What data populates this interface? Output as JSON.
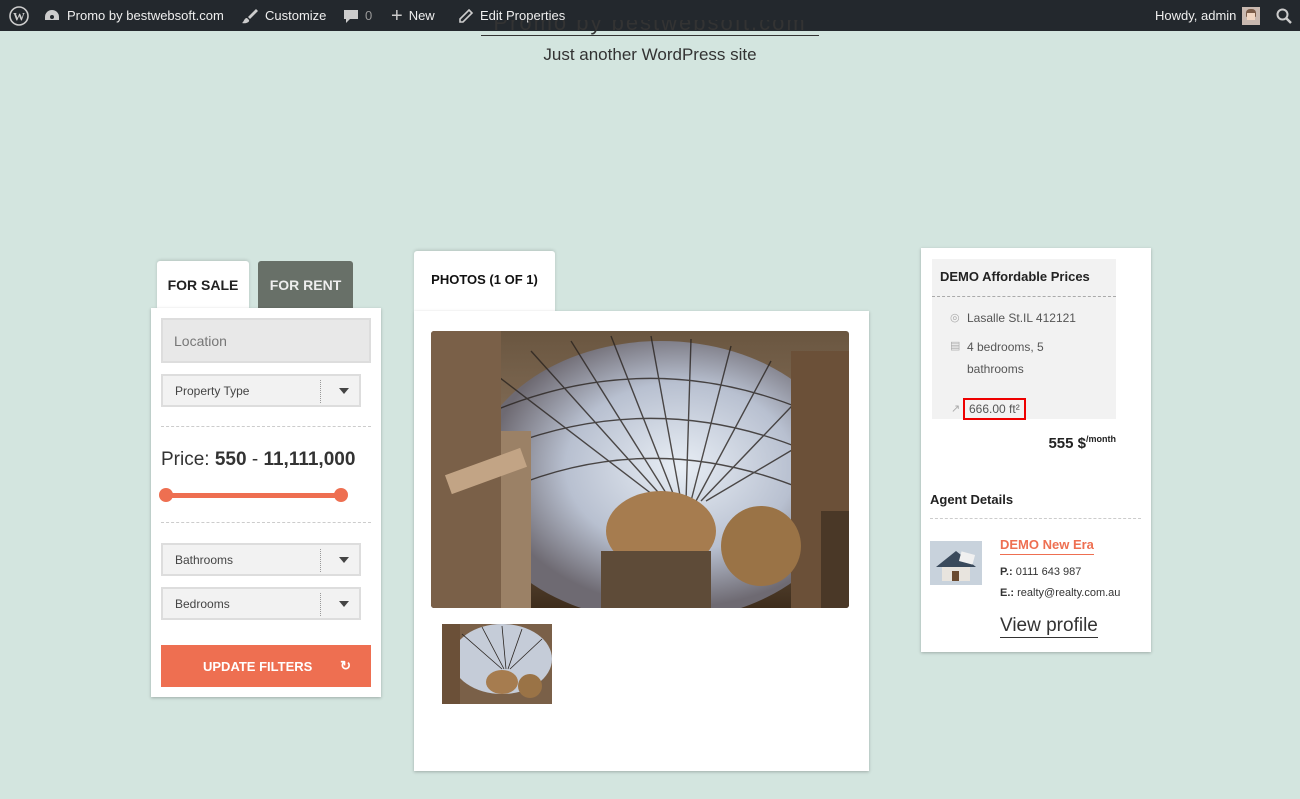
{
  "admin_bar": {
    "wp_logo_icon": "wordpress-icon",
    "site_name": "Promo by bestwebsoft.com",
    "customize": "Customize",
    "comments_count": "0",
    "new": "New",
    "edit": "Edit Properties",
    "howdy": "Howdy, admin",
    "colors": {
      "background": "#23282d"
    }
  },
  "site": {
    "title": "Promo by bestwebsoft.com",
    "description": "Just another WordPress site"
  },
  "search": {
    "tabs": [
      "FOR SALE",
      "FOR RENT"
    ],
    "location_placeholder": "Location",
    "property_type": "Property Type",
    "price_label": "Price:",
    "price_min": "550",
    "price_sep": "-",
    "price_max": "11,111,000",
    "bathrooms": "Bathrooms",
    "bedrooms": "Bedrooms",
    "update_button": "UPDATE FILTERS",
    "accent_color": "#ee6f51"
  },
  "photos": {
    "tab_label": "PHOTOS (1 OF 1)"
  },
  "property": {
    "title": "DEMO Affordable Prices",
    "address": "Lasalle St.IL 412121",
    "rooms": "4 bedrooms, 5 bathrooms",
    "area": "666.00 ft²",
    "price": "555 $",
    "price_unit": "/month"
  },
  "agent": {
    "heading": "Agent Details",
    "name": "DEMO New Era",
    "phone_label": "P.:",
    "phone": "0111 643 987",
    "email_label": "E.:",
    "email": "realty@realty.com.au",
    "view_profile": "View profile"
  }
}
